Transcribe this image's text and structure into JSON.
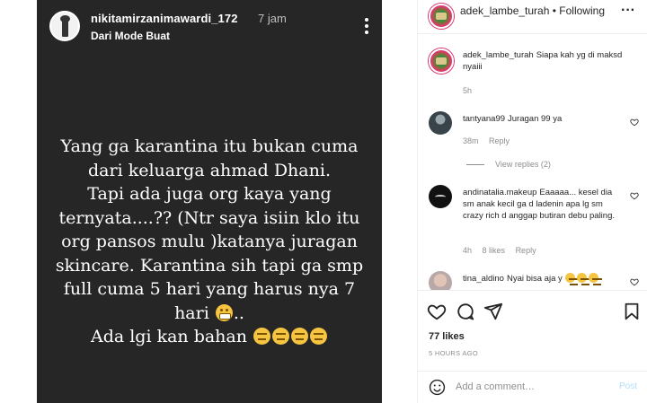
{
  "story": {
    "username": "nikitamirzanimawardi_172",
    "time": "7 jam",
    "subtitle": "Dari Mode Buat",
    "lines": [
      "Yang ga karantina itu bukan cuma",
      "dari keluarga ahmad Dhani.",
      "Tapi ada juga org kaya yang",
      "ternyata....?? (Ntr saya isiin klo itu",
      "org pansos mulu )katanya juragan",
      "skincare. Karantina sih tapi ga smp",
      "full cuma 5 hari yang harus nya 7",
      "hari",
      "..",
      "Ada lgi kan bahan"
    ]
  },
  "post": {
    "header": {
      "username": "adek_lambe_turah",
      "separator": "•",
      "follow_label": "Following",
      "more_icon": "more-horizontal-icon"
    },
    "caption": {
      "username": "adek_lambe_turah",
      "text": "Siapa kah yg di maksd nyaiii",
      "time": "5h"
    },
    "comments": [
      {
        "username": "tantyana99",
        "text": "Juragan 99 ya",
        "time": "38m",
        "reply": "Reply",
        "view_replies": "View replies (2)"
      },
      {
        "username": "andinatalia.makeup",
        "text": "Eaaaaa... kesel dia sm anak kecil ga d ladenin apa lg sm crazy rich d anggap butiran debu paling.",
        "time": "4h",
        "likes": "8 likes",
        "reply": "Reply"
      },
      {
        "username": "tina_aldino",
        "text": "Nyai bisa aja y"
      }
    ],
    "actions": {
      "like_icon": "heart-icon",
      "comment_icon": "comment-icon",
      "share_icon": "share-icon",
      "save_icon": "bookmark-icon"
    },
    "likes": "77 likes",
    "posted_time": "5 HOURS AGO",
    "add_comment_placeholder": "Add a comment…",
    "post_label": "Post"
  },
  "colors": {
    "story_bg": "#262626",
    "meta_text": "#8e8e8e",
    "post_button_disabled": "#b2dffc"
  }
}
